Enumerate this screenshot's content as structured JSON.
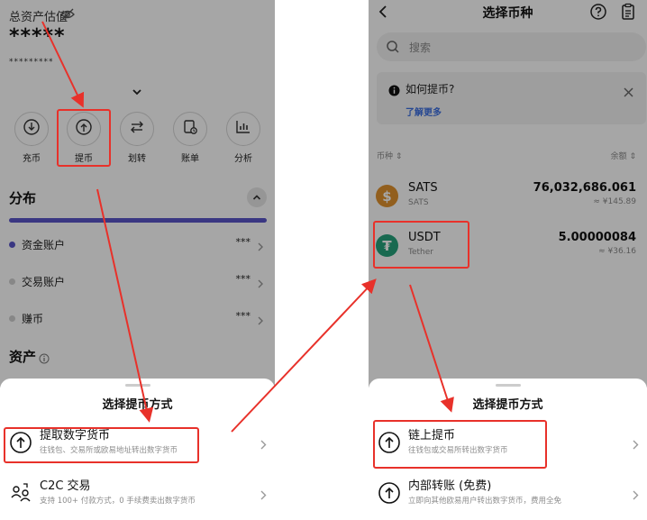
{
  "left_screen": {
    "asset_label": "总资产估值",
    "balance_masked": "*****",
    "sub_balance_masked": "*********",
    "actions": [
      {
        "label": "充币",
        "icon": "deposit-icon"
      },
      {
        "label": "提币",
        "icon": "withdraw-icon"
      },
      {
        "label": "划转",
        "icon": "transfer-icon"
      },
      {
        "label": "账单",
        "icon": "bill-icon"
      },
      {
        "label": "分析",
        "icon": "analysis-icon"
      }
    ],
    "distribution_title": "分布",
    "accounts": [
      {
        "name": "资金账户",
        "value": "***",
        "dot_color": "#5a55c8"
      },
      {
        "name": "交易账户",
        "value": "***",
        "dot_color": "#cfcfcf"
      },
      {
        "name": "赚币",
        "value": "***",
        "dot_color": "#cfcfcf"
      }
    ],
    "assets_title": "资产",
    "sheet": {
      "title": "选择提币方式",
      "options": [
        {
          "title": "提取数字货币",
          "desc": "往钱包、交易所或欧易地址转出数字货币"
        },
        {
          "title": "C2C 交易",
          "desc": "支持 100+ 付款方式，0 手续费卖出数字货币"
        }
      ]
    }
  },
  "right_screen": {
    "title": "选择币种",
    "search_placeholder": "搜索",
    "help_box": {
      "question": "如何提币?",
      "link": "了解更多"
    },
    "col_coin": "币种 ⇕",
    "col_balance": "余额 ⇕",
    "coins": [
      {
        "symbol": "SATS",
        "name": "SATS",
        "amount": "76,032,686.061",
        "fiat": "≈ ¥145.89",
        "color": "#e0922f",
        "glyph": "$"
      },
      {
        "symbol": "USDT",
        "name": "Tether",
        "amount": "5.00000084",
        "fiat": "≈ ¥36.16",
        "color": "#26a17b",
        "glyph": "₮"
      }
    ],
    "sheet": {
      "title": "选择提币方式",
      "options": [
        {
          "title": "链上提币",
          "desc": "往钱包或交易所转出数字货币"
        },
        {
          "title": "内部转账 (免费)",
          "desc": "立即向其他欧易用户转出数字货币，费用全免"
        }
      ]
    }
  },
  "colors": {
    "accent": "#5a55c8",
    "annotation_red": "#e8312a",
    "link_blue": "#3d6fe0"
  }
}
